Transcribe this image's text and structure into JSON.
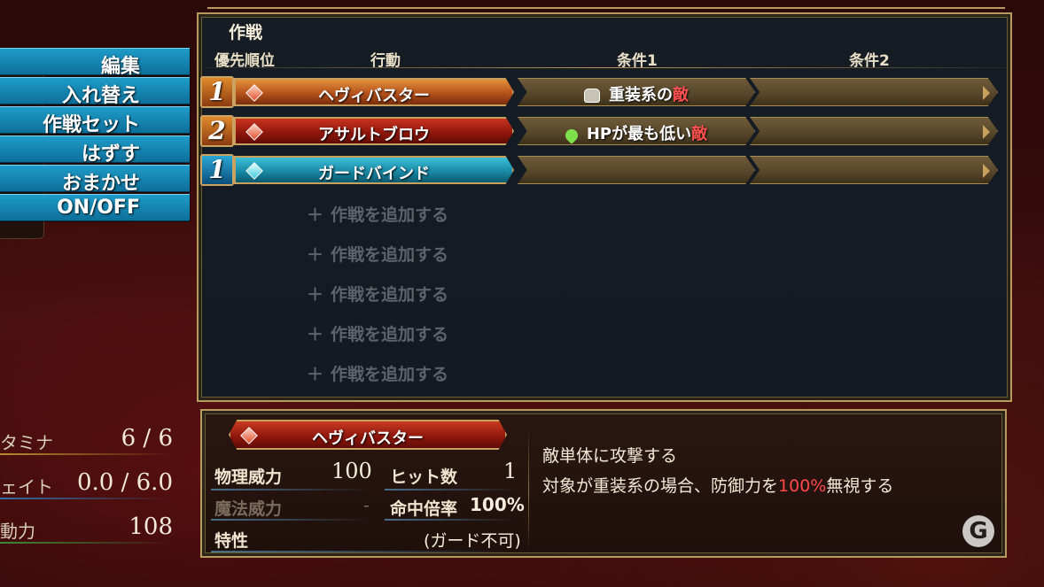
{
  "menu": {
    "items": [
      {
        "label": "編集"
      },
      {
        "label": "入れ替え"
      },
      {
        "label": "作戦セット"
      },
      {
        "label": "はずす"
      },
      {
        "label": "おまかせ"
      },
      {
        "label": "ON/OFF"
      }
    ]
  },
  "tactics": {
    "title": "作戦",
    "headers": {
      "priority": "優先順位",
      "action": "行動",
      "cond1": "条件1",
      "cond2": "条件2"
    },
    "rows": [
      {
        "priority": "1",
        "action": "ヘヴィバスター",
        "cond1_prefix": "重装系の",
        "cond1_hl": "敵",
        "cond1_icon": "armor-icon",
        "cond2": ""
      },
      {
        "priority": "2",
        "action": "アサルトブロウ",
        "cond1_prefix": "HPが最も低い",
        "cond1_hl": "敵",
        "cond1_icon": "heart-icon",
        "cond2": ""
      },
      {
        "priority": "1",
        "action": "ガードバインド",
        "cond1_prefix": "",
        "cond1_hl": "",
        "cond1_icon": "",
        "cond2": ""
      }
    ],
    "add_label": "作戦を追加する",
    "add_plus": "＋"
  },
  "stats": [
    {
      "label": "タミナ",
      "value": "6 / 6",
      "bar_color": "#b58d2f"
    },
    {
      "label": "ェイト",
      "value": "0.0 / 6.0",
      "bar_color": "#2f6fa8"
    },
    {
      "label": "動力",
      "value": "108",
      "bar_color": "#3b8c3a"
    }
  ],
  "detail": {
    "skill_name": "ヘヴィバスター",
    "physical_power_label": "物理威力",
    "physical_power_value": "100",
    "hits_label": "ヒット数",
    "hits_value": "1",
    "magic_power_label": "魔法威力",
    "magic_power_value": "-",
    "accuracy_label": "命中倍率",
    "accuracy_value": "100%",
    "trait_label": "特性",
    "trait_value": "(ガード不可)",
    "desc_line1": "敵単体に攻撃する",
    "desc_line2_prefix": "対象が重装系の場合、防御力を",
    "desc_line2_hl": "100%",
    "desc_line2_suffix": "無視する"
  },
  "logo_text": "G",
  "colors": {
    "accent_gold": "#b8995e",
    "menu_blue": "#1e9cc8",
    "highlight_red": "#ff4848"
  }
}
